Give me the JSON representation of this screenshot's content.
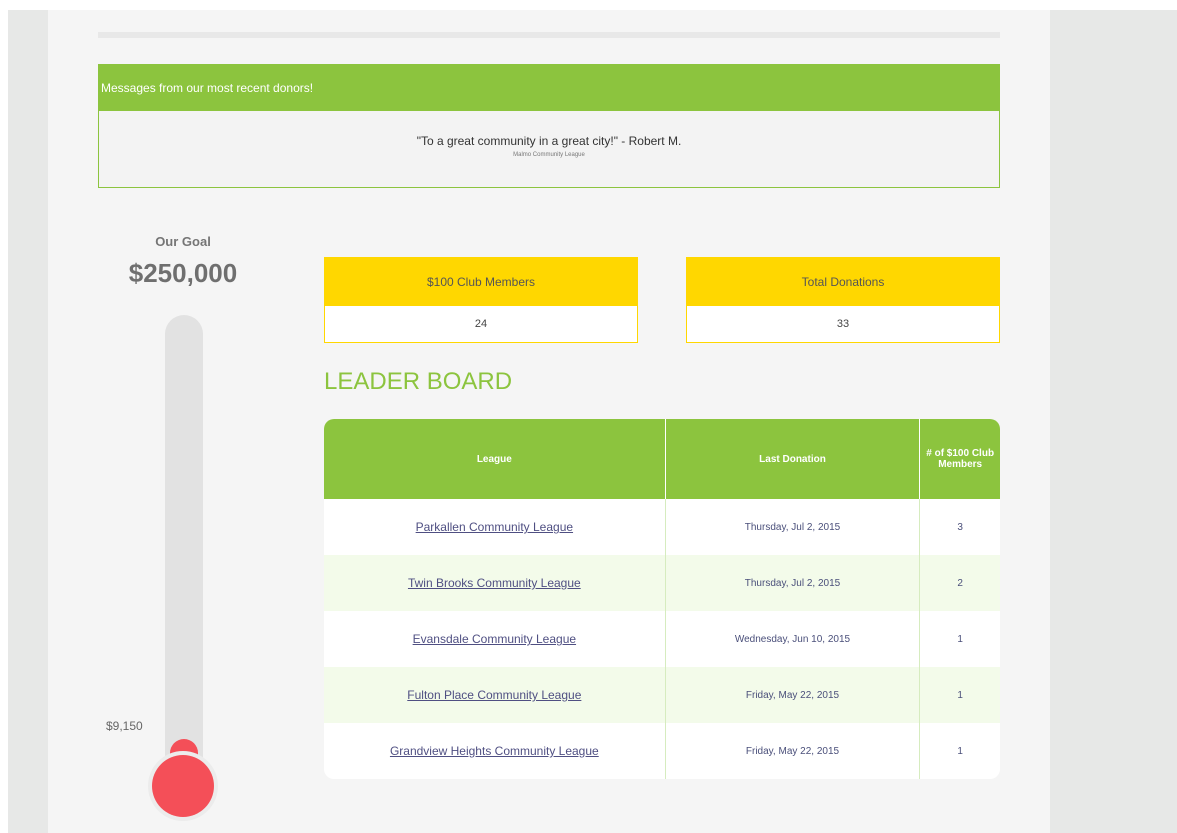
{
  "donors": {
    "header": "Messages from our most recent donors!",
    "quote": "\"To a great community in a great city!\" - Robert M.",
    "league": "Malmo Community League"
  },
  "goal": {
    "label": "Our Goal",
    "amount": "$250,000",
    "raised": "$9,150",
    "progress_fraction": 0.0366
  },
  "stats": {
    "club_members_label": "$100 Club Members",
    "club_members_value": "24",
    "total_donations_label": "Total Donations",
    "total_donations_value": "33"
  },
  "leaderboard": {
    "title": "LEADER BOARD",
    "columns": [
      "League",
      "Last Donation",
      "# of $100 Club Members"
    ],
    "rows": [
      {
        "league": "Parkallen Community League",
        "last_donation": "Thursday, Jul 2, 2015",
        "members": "3"
      },
      {
        "league": "Twin Brooks Community League",
        "last_donation": "Thursday, Jul 2, 2015",
        "members": "2"
      },
      {
        "league": "Evansdale Community League",
        "last_donation": "Wednesday, Jun 10, 2015",
        "members": "1"
      },
      {
        "league": "Fulton Place Community League",
        "last_donation": "Friday, May 22, 2015",
        "members": "1"
      },
      {
        "league": "Grandview Heights Community League",
        "last_donation": "Friday, May 22, 2015",
        "members": "1"
      }
    ]
  },
  "colors": {
    "accent_green": "#8cc43e",
    "accent_yellow": "#ffd700",
    "thermo_red": "#f44f58"
  }
}
